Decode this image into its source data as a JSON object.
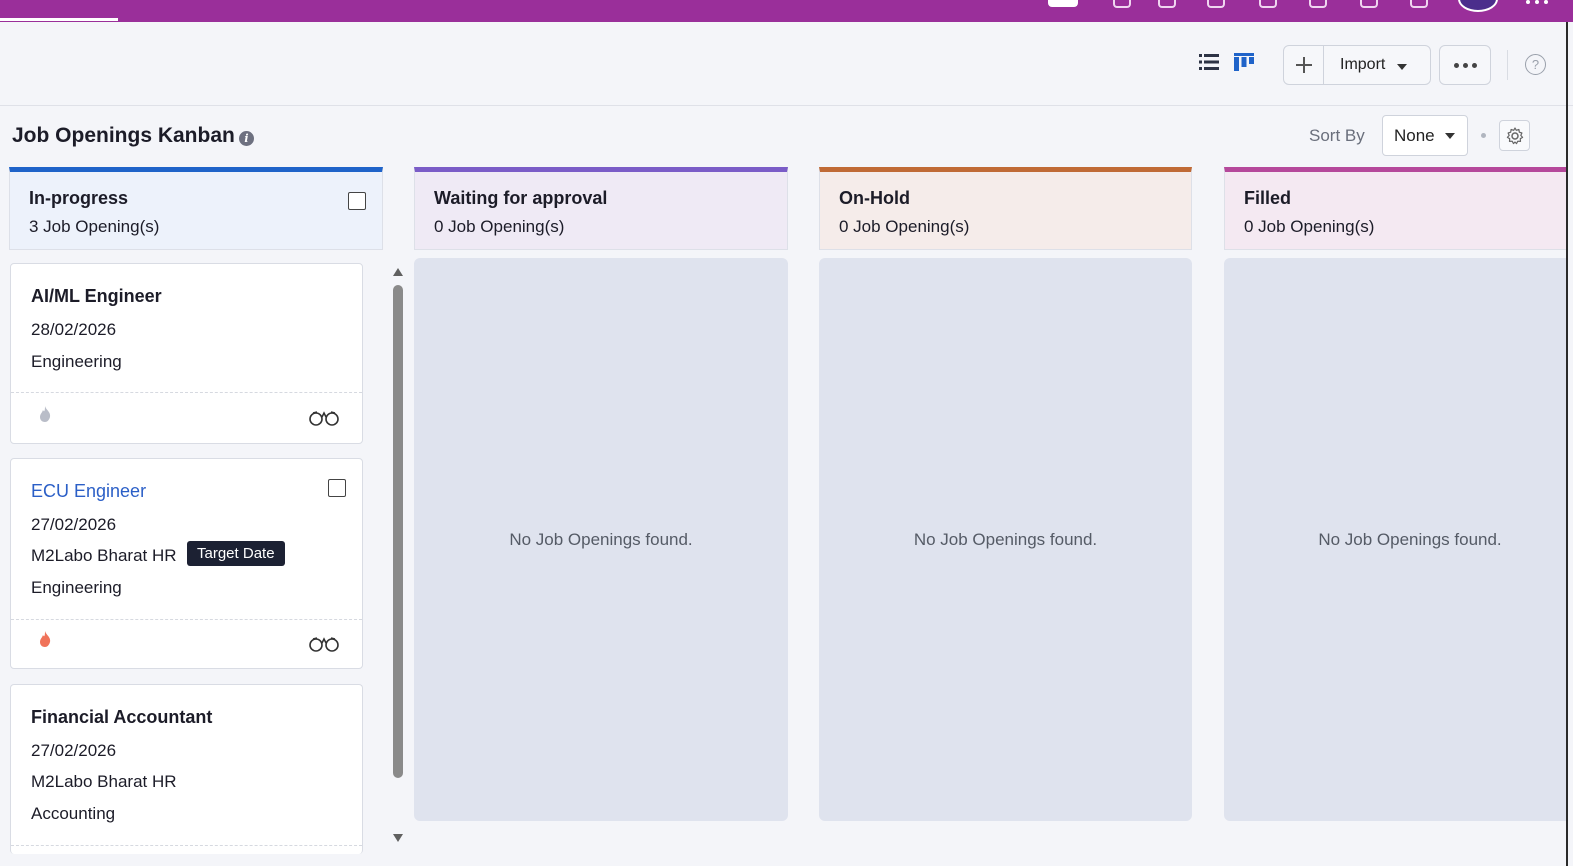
{
  "toolbar": {
    "import_label": "Import",
    "help_label": "?"
  },
  "page": {
    "title": "Job Openings Kanban",
    "info_label": "i",
    "sort_label": "Sort By",
    "sort_value": "None"
  },
  "columns": [
    {
      "name": "In-progress",
      "count": "3 Job Opening(s)",
      "accent": "#1f63c9",
      "bg": "#edf2fb"
    },
    {
      "name": "Waiting for approval",
      "count": "0 Job Opening(s)",
      "accent": "#7a5cc7",
      "bg": "#efeaf5",
      "empty_text": "No Job Openings found."
    },
    {
      "name": "On-Hold",
      "count": "0 Job Opening(s)",
      "accent": "#c06a36",
      "bg": "#f5ecea",
      "empty_text": "No Job Openings found."
    },
    {
      "name": "Filled",
      "count": "0 Job Opening(s)",
      "accent": "#b5489b",
      "bg": "#f4e9f2",
      "empty_text": "No Job Openings found."
    }
  ],
  "cards": [
    {
      "title": "AI/ML Engineer",
      "date": "28/02/2026",
      "department": "Engineering",
      "flame_color": "#b9bdc8"
    },
    {
      "title": "ECU Engineer",
      "date": "27/02/2026",
      "owner": "M2Labo Bharat HR",
      "department": "Engineering",
      "flame_color": "#f0735a",
      "tooltip": "Target Date"
    },
    {
      "title": "Financial Accountant",
      "date": "27/02/2026",
      "owner": "M2Labo Bharat HR",
      "department": "Accounting"
    }
  ],
  "icons": {
    "list_view": "list-icon",
    "kanban_view": "kanban-icon",
    "add": "plus-icon",
    "more": "more-icon",
    "settings": "gear-icon",
    "hot": "flame-icon",
    "watch": "binoculars-icon"
  }
}
